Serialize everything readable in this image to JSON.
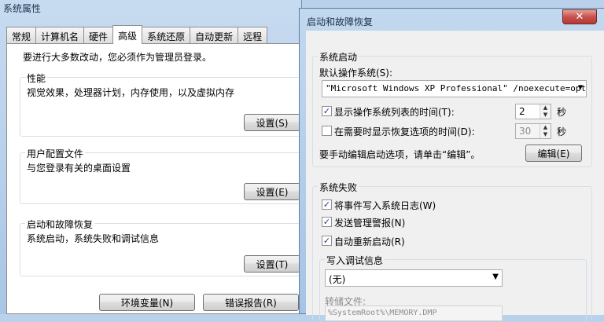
{
  "back_window": {
    "title": "系统属性",
    "tabs": [
      "常规",
      "计算机名",
      "硬件",
      "高级",
      "系统还原",
      "自动更新",
      "远程"
    ],
    "active_tab": 3,
    "intro": "要进行大多数改动，您必须作为管理员登录。",
    "performance": {
      "legend": "性能",
      "desc": "视觉效果，处理器计划，内存使用，以及虚拟内存",
      "button": "设置(S)"
    },
    "user_profiles": {
      "legend": "用户配置文件",
      "desc": "与您登录有关的桌面设置",
      "button": "设置(E)"
    },
    "startup_recovery": {
      "legend": "启动和故障恢复",
      "desc": "系统启动，系统失败和调试信息",
      "button": "设置(T)"
    },
    "env_button": "环境变量(N)",
    "error_button": "错误报告(R)"
  },
  "front_window": {
    "title": "启动和故障恢复",
    "close_glyph": "✕",
    "system_startup": {
      "legend": "系统启动",
      "default_os_label": "默认操作系统(S):",
      "default_os_value": "\"Microsoft Windows XP Professional\" /noexecute=optin",
      "show_os_list_label": "显示操作系统列表的时间(T):",
      "show_os_list_value": "2",
      "show_os_list_checked": true,
      "show_recovery_label": "在需要时显示恢复选项的时间(D):",
      "show_recovery_value": "30",
      "show_recovery_checked": false,
      "seconds": "秒",
      "edit_hint": "要手动编辑启动选项，请单击“编辑”。",
      "edit_button": "编辑(E)"
    },
    "system_failure": {
      "legend": "系统失败",
      "write_event_label": "将事件写入系统日志(W)",
      "send_alert_label": "发送管理警报(N)",
      "auto_restart_label": "自动重新启动(R)",
      "debug_info": {
        "legend": "写入调试信息",
        "select_value": "(无)",
        "dump_file_label": "转储文件:",
        "dump_file_value": "%SystemRoot%\\MEMORY.DMP"
      }
    },
    "check_glyph": "✓"
  }
}
